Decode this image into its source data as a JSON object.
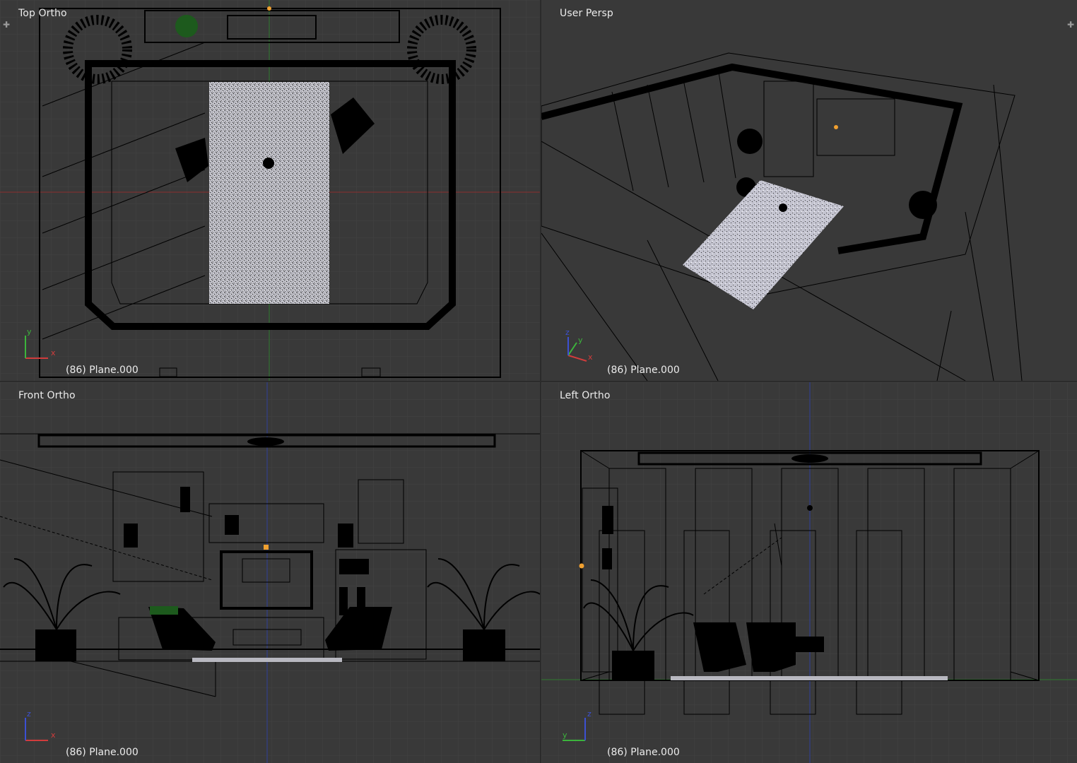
{
  "viewports": {
    "top": {
      "label": "Top Ortho",
      "object": "(86) Plane.000",
      "axis_h": "x",
      "axis_v": "y"
    },
    "persp": {
      "label": "User Persp",
      "object": "(86) Plane.000",
      "axis_h": "x",
      "axis_v": "y",
      "axis_z": "z"
    },
    "front": {
      "label": "Front Ortho",
      "object": "(86) Plane.000",
      "axis_h": "x",
      "axis_v": "z"
    },
    "left": {
      "label": "Left Ortho",
      "object": "(86) Plane.000",
      "axis_h": "y",
      "axis_v": "z"
    }
  },
  "icons": {
    "split_handle": "plus-icon"
  },
  "colors": {
    "viewport_bg": "#393939",
    "grid": "#424242",
    "wire": "#000000",
    "x_axis": "#d23c3c",
    "y_axis": "#3cb43c",
    "z_axis": "#3c50d2",
    "rug": "#bdbdc4",
    "origin": "#f0a030",
    "text": "#ececec"
  }
}
